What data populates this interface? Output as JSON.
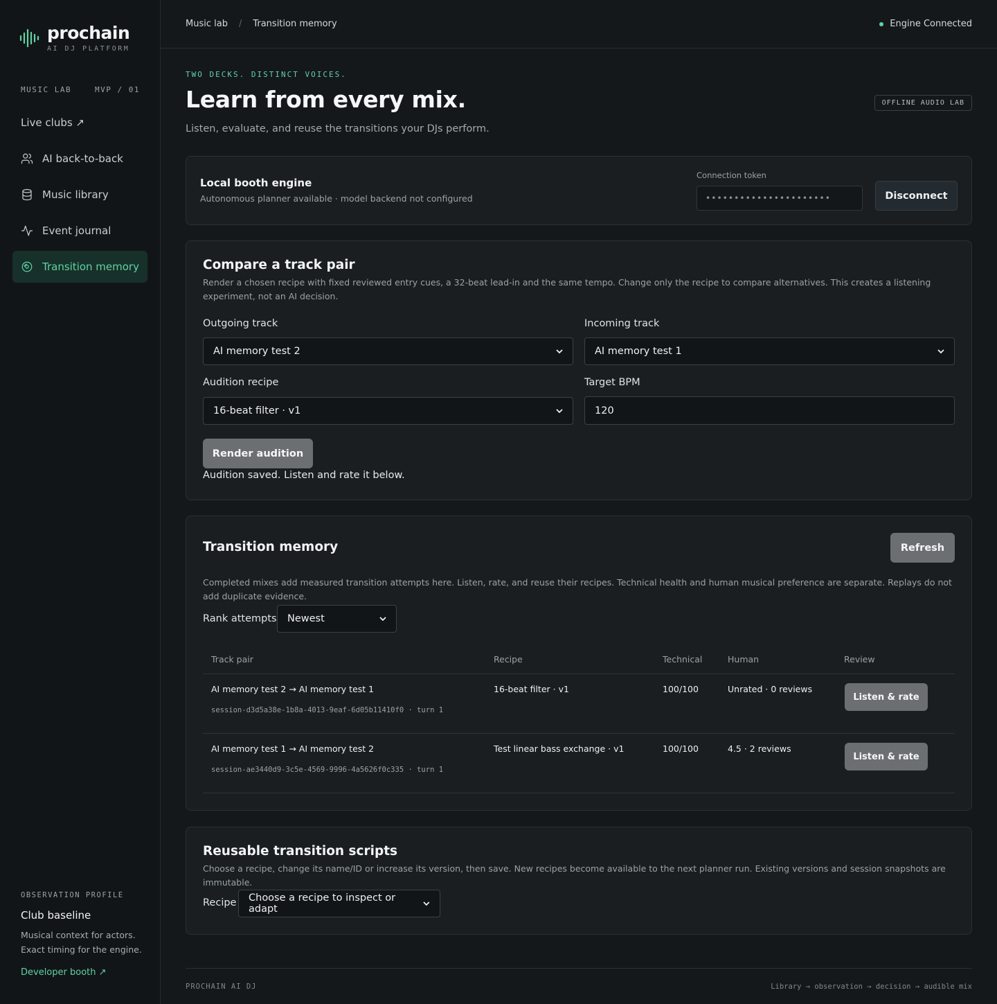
{
  "brand": {
    "name": "prochain",
    "tagline": "AI DJ PLATFORM",
    "accent": "#5fd3a4"
  },
  "sidebar": {
    "section": "MUSIC LAB",
    "version": "MVP / 01",
    "items": [
      {
        "label": "Live clubs ↗",
        "icon": "none"
      },
      {
        "label": "AI back-to-back",
        "icon": "users-icon"
      },
      {
        "label": "Music library",
        "icon": "database-icon"
      },
      {
        "label": "Event journal",
        "icon": "activity-icon"
      },
      {
        "label": "Transition memory",
        "icon": "disc-icon",
        "active": true
      }
    ],
    "observation": {
      "label": "OBSERVATION PROFILE",
      "title": "Club baseline",
      "desc1": "Musical context for actors.",
      "desc2": "Exact timing for the engine.",
      "link": "Developer booth ↗"
    }
  },
  "topbar": {
    "crumb1": "Music lab",
    "crumb_sep": "/",
    "crumb2": "Transition memory",
    "status": "Engine Connected"
  },
  "hero": {
    "eyebrow": "TWO DECKS. DISTINCT VOICES.",
    "title": "Learn from every mix.",
    "subtitle": "Listen, evaluate, and reuse the transitions your DJs perform.",
    "badge": "OFFLINE AUDIO LAB"
  },
  "engine": {
    "title": "Local booth engine",
    "desc": "Autonomous planner available · model backend not configured",
    "token_label": "Connection token",
    "token_value": "••••••••••••••••••••••",
    "disconnect": "Disconnect"
  },
  "compare": {
    "title": "Compare a track pair",
    "desc": "Render a chosen recipe with fixed reviewed entry cues, a 32-beat lead-in and the same tempo. Change only the recipe to compare alternatives. This creates a listening experiment, not an AI decision.",
    "outgoing_label": "Outgoing track",
    "outgoing_value": "AI memory test 2",
    "incoming_label": "Incoming track",
    "incoming_value": "AI memory test 1",
    "recipe_label": "Audition recipe",
    "recipe_value": "16-beat filter · v1",
    "bpm_label": "Target BPM",
    "bpm_value": "120",
    "render": "Render audition",
    "saved": "Audition saved. Listen and rate it below."
  },
  "memory": {
    "title": "Transition memory",
    "refresh": "Refresh",
    "desc": "Completed mixes add measured transition attempts here. Listen, rate, and reuse their recipes. Technical health and human musical preference are separate. Replays do not add duplicate evidence.",
    "rank_label": "Rank attempts",
    "rank_value": "Newest",
    "columns": [
      "Track pair",
      "Recipe",
      "Technical",
      "Human",
      "Review"
    ],
    "rows": [
      {
        "pair": "AI memory test 2 → AI memory test 1",
        "session": "session-d3d5a38e-1b8a-4013-9eaf-6d05b11410f0 · turn 1",
        "recipe": "16-beat filter · v1",
        "technical": "100/100",
        "human": "Unrated · 0 reviews",
        "action": "Listen & rate"
      },
      {
        "pair": "AI memory test 1 → AI memory test 2",
        "session": "session-ae3440d9-3c5e-4569-9996-4a5626f0c335 · turn 1",
        "recipe": "Test linear bass exchange · v1",
        "technical": "100/100",
        "human": "4.5 · 2 reviews",
        "action": "Listen & rate"
      }
    ]
  },
  "scripts": {
    "title": "Reusable transition scripts",
    "desc": "Choose a recipe, change its name/ID or increase its version, then save. New recipes become available to the next planner run. Existing versions and session snapshots are immutable.",
    "recipe_label": "Recipe",
    "recipe_value": "Choose a recipe to inspect or adapt"
  },
  "footer": {
    "left": "PROCHAIN AI DJ",
    "right": "Library → observation → decision → audible mix"
  }
}
